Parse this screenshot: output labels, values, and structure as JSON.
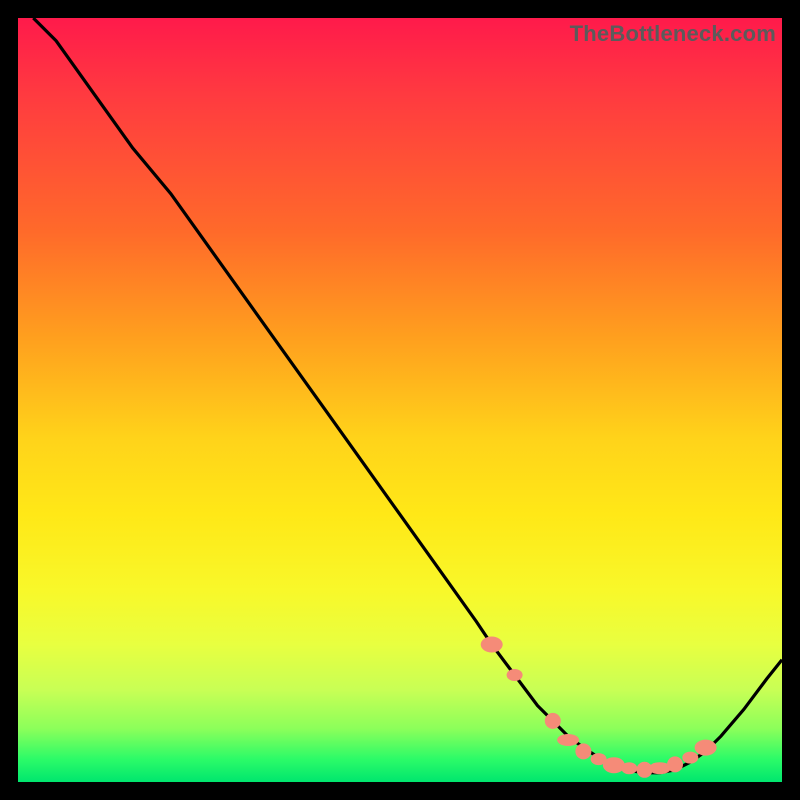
{
  "watermark": "TheBottleneck.com",
  "colors": {
    "background": "#000000",
    "curve": "#000000",
    "marker_fill": "#f58b78",
    "marker_stroke": "#e26a55"
  },
  "chart_data": {
    "type": "line",
    "title": "",
    "xlabel": "",
    "ylabel": "",
    "xlim": [
      0,
      100
    ],
    "ylim": [
      0,
      100
    ],
    "series": [
      {
        "name": "bottleneck-curve",
        "x": [
          2,
          5,
          10,
          15,
          20,
          25,
          30,
          35,
          40,
          45,
          50,
          55,
          60,
          62,
          65,
          68,
          70,
          72,
          74,
          76,
          78,
          80,
          82,
          84,
          86,
          88,
          90,
          92,
          95,
          98,
          100
        ],
        "y": [
          100,
          97,
          90,
          83,
          77,
          70,
          63,
          56,
          49,
          42,
          35,
          28,
          21,
          18,
          14,
          10,
          8,
          6,
          4.5,
          3.2,
          2.2,
          1.5,
          1.2,
          1.2,
          1.6,
          2.6,
          4.0,
          6.0,
          9.5,
          13.5,
          16
        ]
      }
    ],
    "markers": {
      "name": "highlighted-points",
      "x": [
        62,
        65,
        70,
        72,
        74,
        76,
        78,
        80,
        82,
        84,
        86,
        88,
        90
      ],
      "y": [
        18,
        14,
        8,
        5.5,
        4.0,
        3.0,
        2.2,
        1.8,
        1.6,
        1.8,
        2.3,
        3.2,
        4.5
      ]
    }
  }
}
